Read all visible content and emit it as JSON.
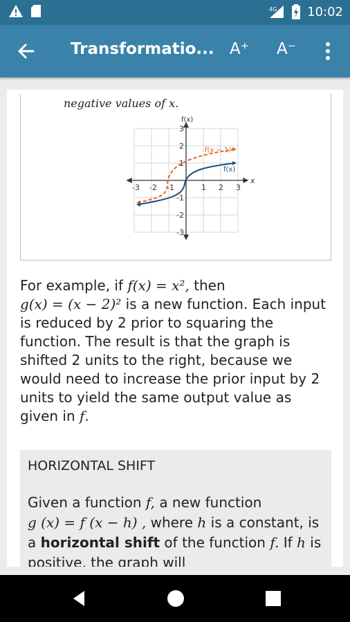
{
  "status_bar": {
    "time": "10:02",
    "network": "4G"
  },
  "app_bar": {
    "title": "Transformatio...",
    "font_increase": "A⁺",
    "font_decrease": "A⁻"
  },
  "figure": {
    "caption_text": "negative values of ",
    "caption_var": "x",
    "caption_end": ".",
    "y_axis_label": "f(x)",
    "x_axis_label": "x",
    "series_shift_label": "f(x − 1)",
    "series_base_label": "f(x)",
    "x_ticks": [
      "-3",
      "-2",
      "-1",
      "1",
      "2",
      "3"
    ],
    "y_ticks": [
      "3",
      "2",
      "1",
      "-1",
      "-2",
      "-3"
    ]
  },
  "paragraph": {
    "p1": "For example, if ",
    "f_def": "f(x) = x², ",
    "p2": " then",
    "g_def": "g(x) = (x − 2)² ",
    "p3": "is a new function. Each input is reduced by 2 prior to squaring the function. The result is that the graph is shifted 2 units to the right, because we would need to increase the prior input by 2 units to yield the same output value as given in ",
    "f": "f",
    "end": "."
  },
  "definition": {
    "heading": "HORIZONTAL SHIFT",
    "t1": "Given a function ",
    "f1": "f, ",
    "t2": " a new function",
    "g_def": "g (x) = f (x − h) , ",
    "t3": "where ",
    "h1": "h",
    "t4": " is a constant, is a ",
    "bold": "horizontal shift",
    "t5": " of the function ",
    "f2": "f. ",
    "t6": " If ",
    "h2": "h",
    "t7": " is positive, the graph will"
  },
  "colors": {
    "status_bar": "#2b6f93",
    "app_bar": "#3b82aa",
    "series_base": "#1f4e79",
    "series_shift": "#e0661f",
    "note_bg": "#ebebeb"
  }
}
